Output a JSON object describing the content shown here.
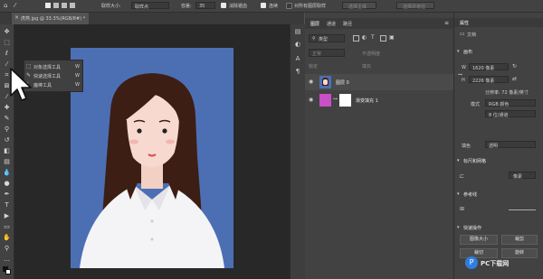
{
  "options_bar": {
    "sample_size_label": "取样大小:",
    "sample_size_value": "取样点",
    "tolerance_label": "容差:",
    "tolerance_value": "35",
    "antialias_label": "消除锯齿",
    "contiguous_label": "连续",
    "all_layers_label": "对所有图层取样",
    "select_subject_label": "选择主体",
    "select_and_mask_label": "选择并遮住"
  },
  "document_tab": {
    "title": "虎燕.jpg @ 33.3%(RGB/8#) *"
  },
  "tool_flyout": {
    "items": [
      {
        "label": "对象选择工具",
        "shortcut": "W"
      },
      {
        "label": "快速选择工具",
        "shortcut": "W"
      },
      {
        "label": "魔棒工具",
        "shortcut": "W"
      }
    ]
  },
  "layers_panel": {
    "tabs": [
      "图层",
      "通道",
      "路径"
    ],
    "filter_kind": "类型",
    "blend_mode": "正常",
    "opacity_label": "不透明度",
    "lock_label": "锁定",
    "fill_label": "填充",
    "layers": [
      {
        "name": "图层 0"
      },
      {
        "name": "渐变填充 1"
      }
    ]
  },
  "properties_panel": {
    "tab": "属性",
    "doc_label": "文档",
    "canvas_section": "画布",
    "width_label": "W",
    "width_value": "1620 像素",
    "height_label": "H",
    "height_value": "2226 像素",
    "resolution_text": "分辨率: 72 像素/英寸",
    "mode_label": "模式",
    "mode_value": "RGB 颜色",
    "bit_depth_value": "8 位/通道",
    "fill_label": "填色",
    "fill_value": "透明",
    "rulers_section": "标尺和网格",
    "unit_value": "像素",
    "guides_section": "参考线",
    "quick_actions_section": "快速操作",
    "btn_image_size": "图像大小",
    "btn_crop": "裁剪",
    "btn_trim": "裁切",
    "btn_rotate": "旋转"
  },
  "watermark": "PC下载网",
  "colors": {
    "canvas_bg": "#4c6fb4",
    "layer_fill_swatch": "#c94fc6"
  }
}
